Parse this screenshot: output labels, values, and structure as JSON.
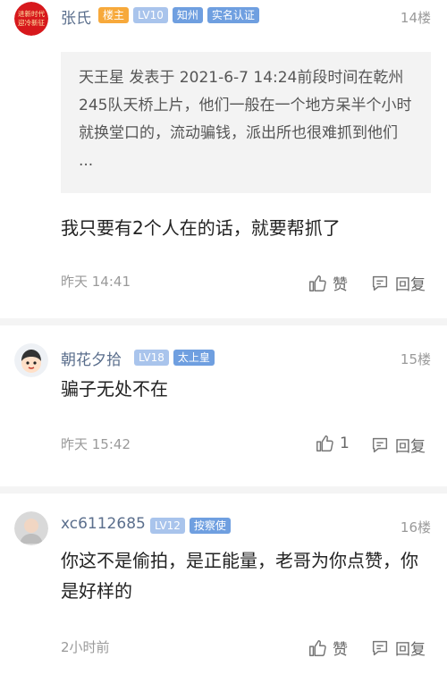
{
  "comments": [
    {
      "user": "张氏",
      "badges": [
        "楼主",
        "LV10",
        "知州",
        "实名认证"
      ],
      "floor": "14楼",
      "avatar_text": [
        "进新时代",
        "迎冷新征"
      ],
      "quote": "天王星 发表于 2021-6-7 14:24前段时间在乾州245队天桥上片，他们一般在一个地方呆半个小时就换堂口的，流动骗钱，派出所也很难抓到他们 ...",
      "text": "我只要有2个人在的话，就要帮抓了",
      "time": "昨天 14:41",
      "like_label": "赞",
      "reply_label": "回复"
    },
    {
      "user": "朝花夕拾",
      "badges": [
        "LV18",
        "太上皇"
      ],
      "floor": "15楼",
      "text": "骗子无处不在",
      "time": "昨天 15:42",
      "like_label": "1",
      "reply_label": "回复"
    },
    {
      "user": "xc6112685",
      "badges": [
        "LV12",
        "按察使"
      ],
      "floor": "16楼",
      "text": "你这不是偷拍，是正能量，老哥为你点赞，你是好样的",
      "time": "2小时前",
      "like_label": "赞",
      "reply_label": "回复"
    }
  ],
  "colors": {
    "username": "#5a6e8c",
    "owner_badge": "#f7a93b",
    "level_badge": "#a9c4ec",
    "title_badge": "#6f9fe0",
    "avatar_red": "#d7181c",
    "separator": "#f4f4f4"
  },
  "icons": {
    "like": "thumbs-up-icon",
    "reply": "reply-bubble-icon"
  }
}
